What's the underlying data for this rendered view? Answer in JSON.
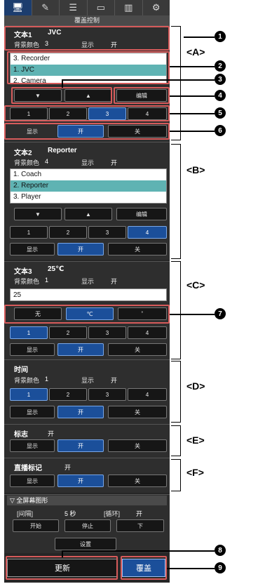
{
  "tabs": [
    {
      "icon": "monitor-icon",
      "glyph": "🖥"
    },
    {
      "icon": "edit-icon",
      "glyph": "✎"
    },
    {
      "icon": "edit-list-icon",
      "glyph": "☰"
    },
    {
      "icon": "display-icon",
      "glyph": "▭"
    },
    {
      "icon": "signal-icon",
      "glyph": "▥"
    },
    {
      "icon": "gear-icon",
      "glyph": "⚙"
    }
  ],
  "subtitle": "覆盖控制",
  "sectionA": {
    "title": "文本1",
    "title_value": "JVC",
    "bg_label": "背景颜色",
    "bg_value": "3",
    "disp_label": "显示",
    "disp_value": "开",
    "list": [
      "3. Recorder",
      "1. JVC",
      "2. Camera"
    ],
    "selected_index": 1,
    "down": "▼",
    "up": "▲",
    "edit": "编辑",
    "nums": [
      "1",
      "2",
      "3",
      "4"
    ],
    "active_num": 2,
    "show": "显示",
    "on": "开",
    "off": "关"
  },
  "sectionB": {
    "title": "文本2",
    "title_value": "Reporter",
    "bg_label": "背景颜色",
    "bg_value": "4",
    "disp_label": "显示",
    "disp_value": "开",
    "list": [
      "1. Coach",
      "2. Reporter",
      "3. Player"
    ],
    "selected_index": 1,
    "down": "▼",
    "up": "▲",
    "edit": "编辑",
    "nums": [
      "1",
      "2",
      "3",
      "4"
    ],
    "active_num": 3,
    "show": "显示",
    "on": "开",
    "off": "关"
  },
  "sectionC": {
    "title": "文本3",
    "title_value": "25℃",
    "bg_label": "背景颜色",
    "bg_value": "1",
    "disp_label": "显示",
    "disp_value": "开",
    "textbox": "25",
    "units": [
      "无",
      "℃",
      "˚"
    ],
    "active_unit": 1,
    "nums": [
      "1",
      "2",
      "3",
      "4"
    ],
    "active_num": 0,
    "show": "显示",
    "on": "开",
    "off": "关"
  },
  "sectionD": {
    "title": "时间",
    "bg_label": "背景颜色",
    "bg_value": "1",
    "disp_label": "显示",
    "disp_value": "开",
    "nums": [
      "1",
      "2",
      "3",
      "4"
    ],
    "active_num": 0,
    "show": "显示",
    "on": "开",
    "off": "关"
  },
  "sectionE": {
    "title": "标志",
    "value": "开",
    "show": "显示",
    "on": "开",
    "off": "关"
  },
  "sectionF": {
    "title": "直播标记",
    "value": "开",
    "show": "显示",
    "on": "开",
    "off": "关"
  },
  "fullscreen": {
    "header": "▽ 全屏幕图形",
    "interval_label": "[间隔]",
    "interval_value": "5 秒",
    "loop_label": "[循环]",
    "loop_value": "开",
    "start": "开始",
    "stop": "停止",
    "next": "下",
    "settings": "设置"
  },
  "footer": {
    "update": "更新",
    "overwrite": "覆盖"
  },
  "annotations": {
    "A": "<A>",
    "B": "<B>",
    "C": "<C>",
    "D": "<D>",
    "E": "<E>",
    "F": "<F>",
    "n1": "1",
    "n2": "2",
    "n3": "3",
    "n4": "4",
    "n5": "5",
    "n6": "6",
    "n7": "7",
    "n8": "8",
    "n9": "9"
  }
}
